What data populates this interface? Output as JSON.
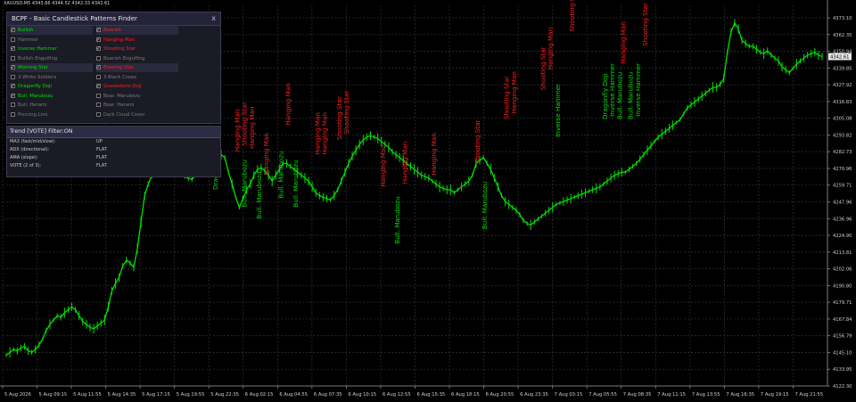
{
  "chart_info": {
    "symbol_label": "XAUUSD,M5",
    "ohlc_text": "4343.66 4344.52 4342.33 4342.61"
  },
  "panel": {
    "title": "BCPF - Basic Candlestick Patterns Finder",
    "close_label": "x",
    "left_items": [
      {
        "label": "Bullish",
        "checked": true,
        "color": "#00e000",
        "highlight": true
      },
      {
        "label": "Hammer",
        "checked": false,
        "color": "#7a7a7a",
        "highlight": false
      },
      {
        "label": "Inverse Hammer",
        "checked": true,
        "color": "#00e000",
        "highlight": false
      },
      {
        "label": "Bullish Engulfing",
        "checked": false,
        "color": "#7a7a7a",
        "highlight": false
      },
      {
        "label": "Morning Star",
        "checked": true,
        "color": "#00e000",
        "highlight": true
      },
      {
        "label": "3 White Soldiers",
        "checked": false,
        "color": "#7a7a7a",
        "highlight": false
      },
      {
        "label": "Dragonfly Doji",
        "checked": true,
        "color": "#00e000",
        "highlight": false
      },
      {
        "label": "Bull. Marubozu",
        "checked": true,
        "color": "#00e000",
        "highlight": false
      },
      {
        "label": "Bull. Harami",
        "checked": false,
        "color": "#7a7a7a",
        "highlight": false
      },
      {
        "label": "Piercing Line",
        "checked": false,
        "color": "#7a7a7a",
        "highlight": false
      }
    ],
    "right_items": [
      {
        "label": "Bearish",
        "checked": true,
        "color": "#ff2020",
        "highlight": true
      },
      {
        "label": "Hanging Man",
        "checked": true,
        "color": "#ff2020",
        "highlight": false
      },
      {
        "label": "Shooting Star",
        "checked": true,
        "color": "#ff2020",
        "highlight": false
      },
      {
        "label": "Bearish Engulfing",
        "checked": false,
        "color": "#7a7a7a",
        "highlight": false
      },
      {
        "label": "Evening Star",
        "checked": true,
        "color": "#ff2020",
        "highlight": true
      },
      {
        "label": "3 Black Crows",
        "checked": false,
        "color": "#7a7a7a",
        "highlight": false
      },
      {
        "label": "Gravestone Doji",
        "checked": true,
        "color": "#ff2020",
        "highlight": false
      },
      {
        "label": "Bear. Marubozu",
        "checked": false,
        "color": "#7a7a7a",
        "highlight": false
      },
      {
        "label": "Bear. Harami",
        "checked": false,
        "color": "#7a7a7a",
        "highlight": false
      },
      {
        "label": "Dark Cloud Cover",
        "checked": false,
        "color": "#7a7a7a",
        "highlight": false
      }
    ]
  },
  "trend": {
    "title": "Trend [VOTE]  Filter:ON",
    "rows": [
      {
        "label": "MA3 (fast/mid/slow):",
        "value": "UP"
      },
      {
        "label": "ADX (directional):",
        "value": "FLAT"
      },
      {
        "label": "AMA (slope):",
        "value": "FLAT"
      },
      {
        "label": "VOTE (2 of 3):",
        "value": "FLAT"
      }
    ]
  },
  "chart_data": {
    "type": "line",
    "series": [
      {
        "values": [
          4139,
          4141,
          4143,
          4142,
          4144,
          4145,
          4142,
          4141,
          4143,
          4146,
          4150,
          4156,
          4160,
          4163,
          4166,
          4165,
          4168,
          4170,
          4172,
          4170,
          4166,
          4162,
          4160,
          4158,
          4157,
          4159,
          4161,
          4163,
          4172,
          4183,
          4188,
          4192,
          4200,
          4204,
          4202,
          4199,
          4212,
          4230,
          4248,
          4256,
          4262,
          4268,
          4271,
          4273,
          4272,
          4271,
          4269,
          4265,
          4263,
          4261,
          4260,
          4259,
          4262,
          4264,
          4266,
          4268,
          4270,
          4272,
          4274,
          4276,
          4274,
          4264,
          4256,
          4247,
          4240,
          4246,
          4252,
          4256,
          4262,
          4266,
          4267,
          4265,
          4262,
          4258,
          4262,
          4266,
          4270,
          4270,
          4268,
          4266,
          4264,
          4262,
          4260,
          4258,
          4254,
          4250,
          4248,
          4247,
          4246,
          4245,
          4248,
          4252,
          4258,
          4264,
          4270,
          4275,
          4279,
          4283,
          4286,
          4288,
          4289,
          4288,
          4287,
          4285,
          4283,
          4281,
          4278,
          4276,
          4274,
          4272,
          4270,
          4268,
          4266,
          4264,
          4262,
          4261,
          4260,
          4258,
          4256,
          4254,
          4253,
          4252,
          4252,
          4250,
          4252,
          4254,
          4256,
          4258,
          4262,
          4270,
          4272,
          4274,
          4270,
          4266,
          4260,
          4254,
          4248,
          4244,
          4242,
          4240,
          4238,
          4235,
          4231,
          4229,
          4228,
          4230,
          4232,
          4234,
          4236,
          4238,
          4240,
          4242,
          4243,
          4244,
          4245,
          4246,
          4247,
          4248,
          4249,
          4250,
          4251,
          4252,
          4253,
          4254,
          4256,
          4258,
          4260,
          4262,
          4263,
          4264,
          4264,
          4266,
          4268,
          4270,
          4273,
          4276,
          4279,
          4282,
          4285,
          4288,
          4290,
          4292,
          4294,
          4296,
          4298,
          4300,
          4304,
          4308,
          4310,
          4312,
          4314,
          4316,
          4318,
          4320,
          4322,
          4322,
          4324,
          4328,
          4346,
          4360,
          4366,
          4362,
          4354,
          4352,
          4350,
          4350,
          4348,
          4346,
          4345,
          4347,
          4344,
          4342,
          4340,
          4336,
          4334,
          4332,
          4335,
          4338,
          4340,
          4342,
          4344,
          4345,
          4346,
          4344,
          4343
        ],
        "color": "#00e000"
      }
    ],
    "y_ticks": [
      "4373.10",
      "4362.35",
      "4350.94",
      "4339.85",
      "4327.92",
      "4316.83",
      "4305.08",
      "4293.82",
      "4282.73",
      "4270.96",
      "4259.71",
      "4247.96",
      "4236.96",
      "4224.90",
      "4213.81",
      "4202.06",
      "4190.80",
      "4179.71",
      "4167.84",
      "4156.79",
      "4145.10",
      "4133.95",
      "4122.30"
    ],
    "x_ticks": [
      "5 Aug 2026",
      "5 Aug 09:15",
      "5 Aug 11:55",
      "5 Aug 14:35",
      "5 Aug 17:15",
      "5 Aug 19:55",
      "5 Aug 22:35",
      "6 Aug 02:15",
      "6 Aug 04:55",
      "6 Aug 07:35",
      "6 Aug 10:15",
      "6 Aug 12:55",
      "6 Aug 15:35",
      "6 Aug 18:15",
      "6 Aug 20:55",
      "6 Aug 23:35",
      "7 Aug 03:15",
      "7 Aug 05:55",
      "7 Aug 08:35",
      "7 Aug 11:15",
      "7 Aug 13:55",
      "7 Aug 16:35",
      "7 Aug 19:15",
      "7 Aug 21:55"
    ],
    "ylim": [
      4118,
      4378
    ],
    "current_price_label": "4342.61",
    "grid": true,
    "annotations": [
      {
        "text": "Dragonfly Doji",
        "bar": 58,
        "price": 4252,
        "color": "#00e000"
      },
      {
        "text": "Hanging Man",
        "bar": 64,
        "price": 4278,
        "color": "#ff2020"
      },
      {
        "text": "Bull. Marubozu",
        "bar": 66,
        "price": 4240,
        "color": "#00e000"
      },
      {
        "text": "Shooting Star",
        "bar": 66,
        "price": 4282,
        "color": "#ff2020"
      },
      {
        "text": "Hanging Man",
        "bar": 68,
        "price": 4280,
        "color": "#ff2020"
      },
      {
        "text": "Bull. Marubozu",
        "bar": 70,
        "price": 4232,
        "color": "#00e000"
      },
      {
        "text": "Hanging Man",
        "bar": 72,
        "price": 4262,
        "color": "#ff2020"
      },
      {
        "text": "Bull. Marubozu",
        "bar": 76,
        "price": 4246,
        "color": "#00e000"
      },
      {
        "text": "Hanging Man",
        "bar": 78,
        "price": 4296,
        "color": "#ff2020"
      },
      {
        "text": "Bull. Marubozu",
        "bar": 80,
        "price": 4240,
        "color": "#00e000"
      },
      {
        "text": "Hanging Man",
        "bar": 86,
        "price": 4276,
        "color": "#ff2020"
      },
      {
        "text": "Hanging Man",
        "bar": 88,
        "price": 4276,
        "color": "#ff2020"
      },
      {
        "text": "Shooting Star",
        "bar": 92,
        "price": 4286,
        "color": "#ff2020"
      },
      {
        "text": "Shooting Star",
        "bar": 94,
        "price": 4290,
        "color": "#ff2020"
      },
      {
        "text": "Hanging Man",
        "bar": 104,
        "price": 4254,
        "color": "#ff2020"
      },
      {
        "text": "Bull. Marubozu",
        "bar": 108,
        "price": 4215,
        "color": "#00e000"
      },
      {
        "text": "Hanging Man",
        "bar": 110,
        "price": 4256,
        "color": "#ff2020"
      },
      {
        "text": "Hanging Man",
        "bar": 118,
        "price": 4262,
        "color": "#ff2020"
      },
      {
        "text": "Shooting Star",
        "bar": 130,
        "price": 4270,
        "color": "#ff2020"
      },
      {
        "text": "Bull. Marubozu",
        "bar": 132,
        "price": 4225,
        "color": "#00e000"
      },
      {
        "text": "Shooting Star",
        "bar": 138,
        "price": 4300,
        "color": "#ff2020"
      },
      {
        "text": "Hanging Man",
        "bar": 140,
        "price": 4304,
        "color": "#ff2020"
      },
      {
        "text": "Shooting Star",
        "bar": 148,
        "price": 4320,
        "color": "#ff2020"
      },
      {
        "text": "Hanging Man",
        "bar": 150,
        "price": 4334,
        "color": "#ff2020"
      },
      {
        "text": "Inverse Hammer",
        "bar": 152,
        "price": 4288,
        "color": "#00e000"
      },
      {
        "text": "Shooting Star",
        "bar": 156,
        "price": 4360,
        "color": "#ff2020"
      },
      {
        "text": "Dragonfly Doji",
        "bar": 165,
        "price": 4300,
        "color": "#00e000"
      },
      {
        "text": "Inverse Hammer",
        "bar": 167,
        "price": 4302,
        "color": "#00e000"
      },
      {
        "text": "Bull. Marubozu",
        "bar": 169,
        "price": 4300,
        "color": "#00e000"
      },
      {
        "text": "Hanging Man",
        "bar": 170,
        "price": 4338,
        "color": "#ff2020"
      },
      {
        "text": "Bull. Marubozu",
        "bar": 172,
        "price": 4300,
        "color": "#00e000"
      },
      {
        "text": "Inverse Hammer",
        "bar": 174,
        "price": 4302,
        "color": "#00e000"
      },
      {
        "text": "Shooting Star",
        "bar": 176,
        "price": 4350,
        "color": "#ff2020"
      }
    ]
  }
}
